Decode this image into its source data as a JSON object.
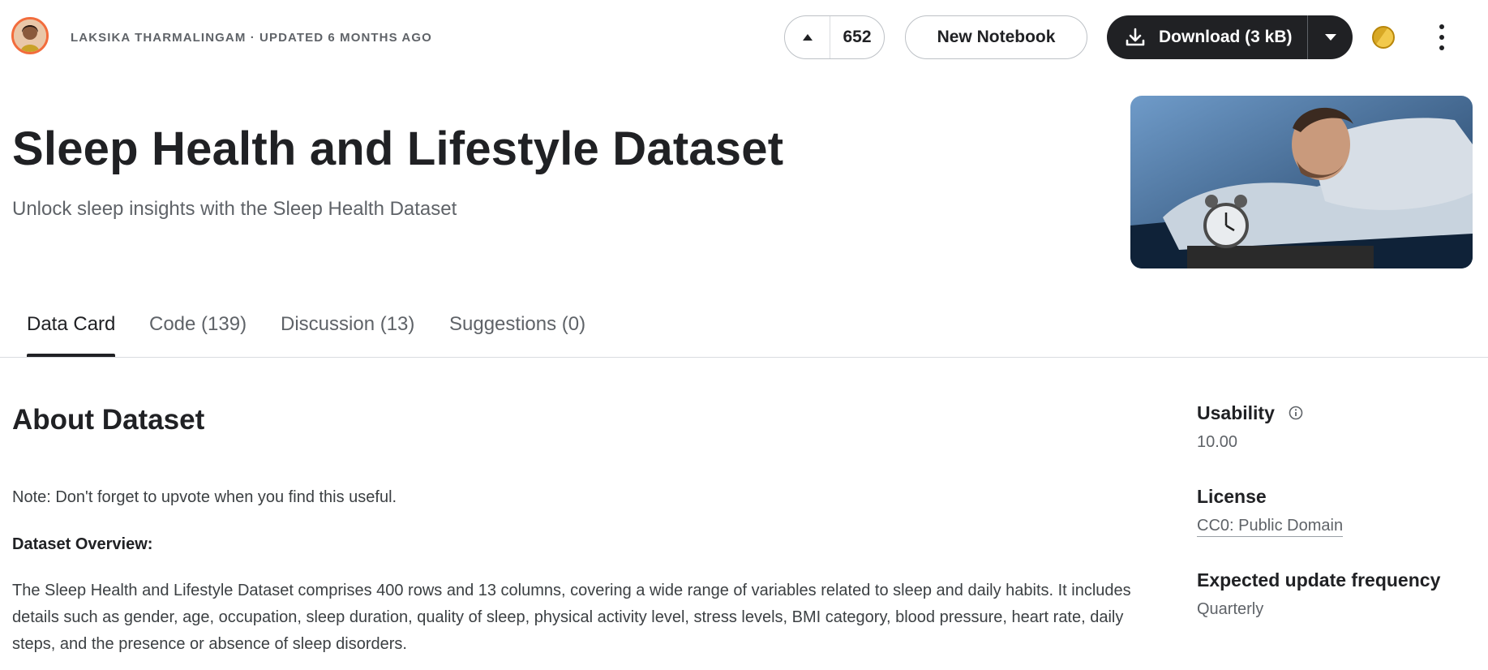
{
  "header": {
    "owner_line": "Laksika Tharmalingam · Updated 6 months ago",
    "vote_count": "652",
    "new_notebook_label": "New Notebook",
    "download_label": "Download (3 kB)"
  },
  "dataset": {
    "title": "Sleep Health and Lifestyle Dataset",
    "subtitle": "Unlock sleep insights with the Sleep Health Dataset"
  },
  "tabs": [
    {
      "label": "Data Card",
      "active": true
    },
    {
      "label": "Code (139)",
      "active": false
    },
    {
      "label": "Discussion (13)",
      "active": false
    },
    {
      "label": "Suggestions (0)",
      "active": false
    }
  ],
  "about": {
    "heading": "About Dataset",
    "note": "Note: Don't forget to upvote when you find this useful.",
    "overview_heading": "Dataset Overview:",
    "overview_text": "The Sleep Health and Lifestyle Dataset comprises 400 rows and 13 columns, covering a wide range of variables related to sleep and daily habits. It includes details such as gender, age, occupation, sleep duration, quality of sleep, physical activity level, stress levels, BMI category, blood pressure, heart rate, daily steps, and the presence or absence of sleep disorders."
  },
  "sidebar": {
    "usability_label": "Usability",
    "usability_value": "10.00",
    "license_label": "License",
    "license_value": "CC0: Public Domain",
    "frequency_label": "Expected update frequency",
    "frequency_value": "Quarterly"
  },
  "colors": {
    "primary_dark": "#202124",
    "avatar_ring": "#f26c3c",
    "coin": "#d8a825"
  }
}
